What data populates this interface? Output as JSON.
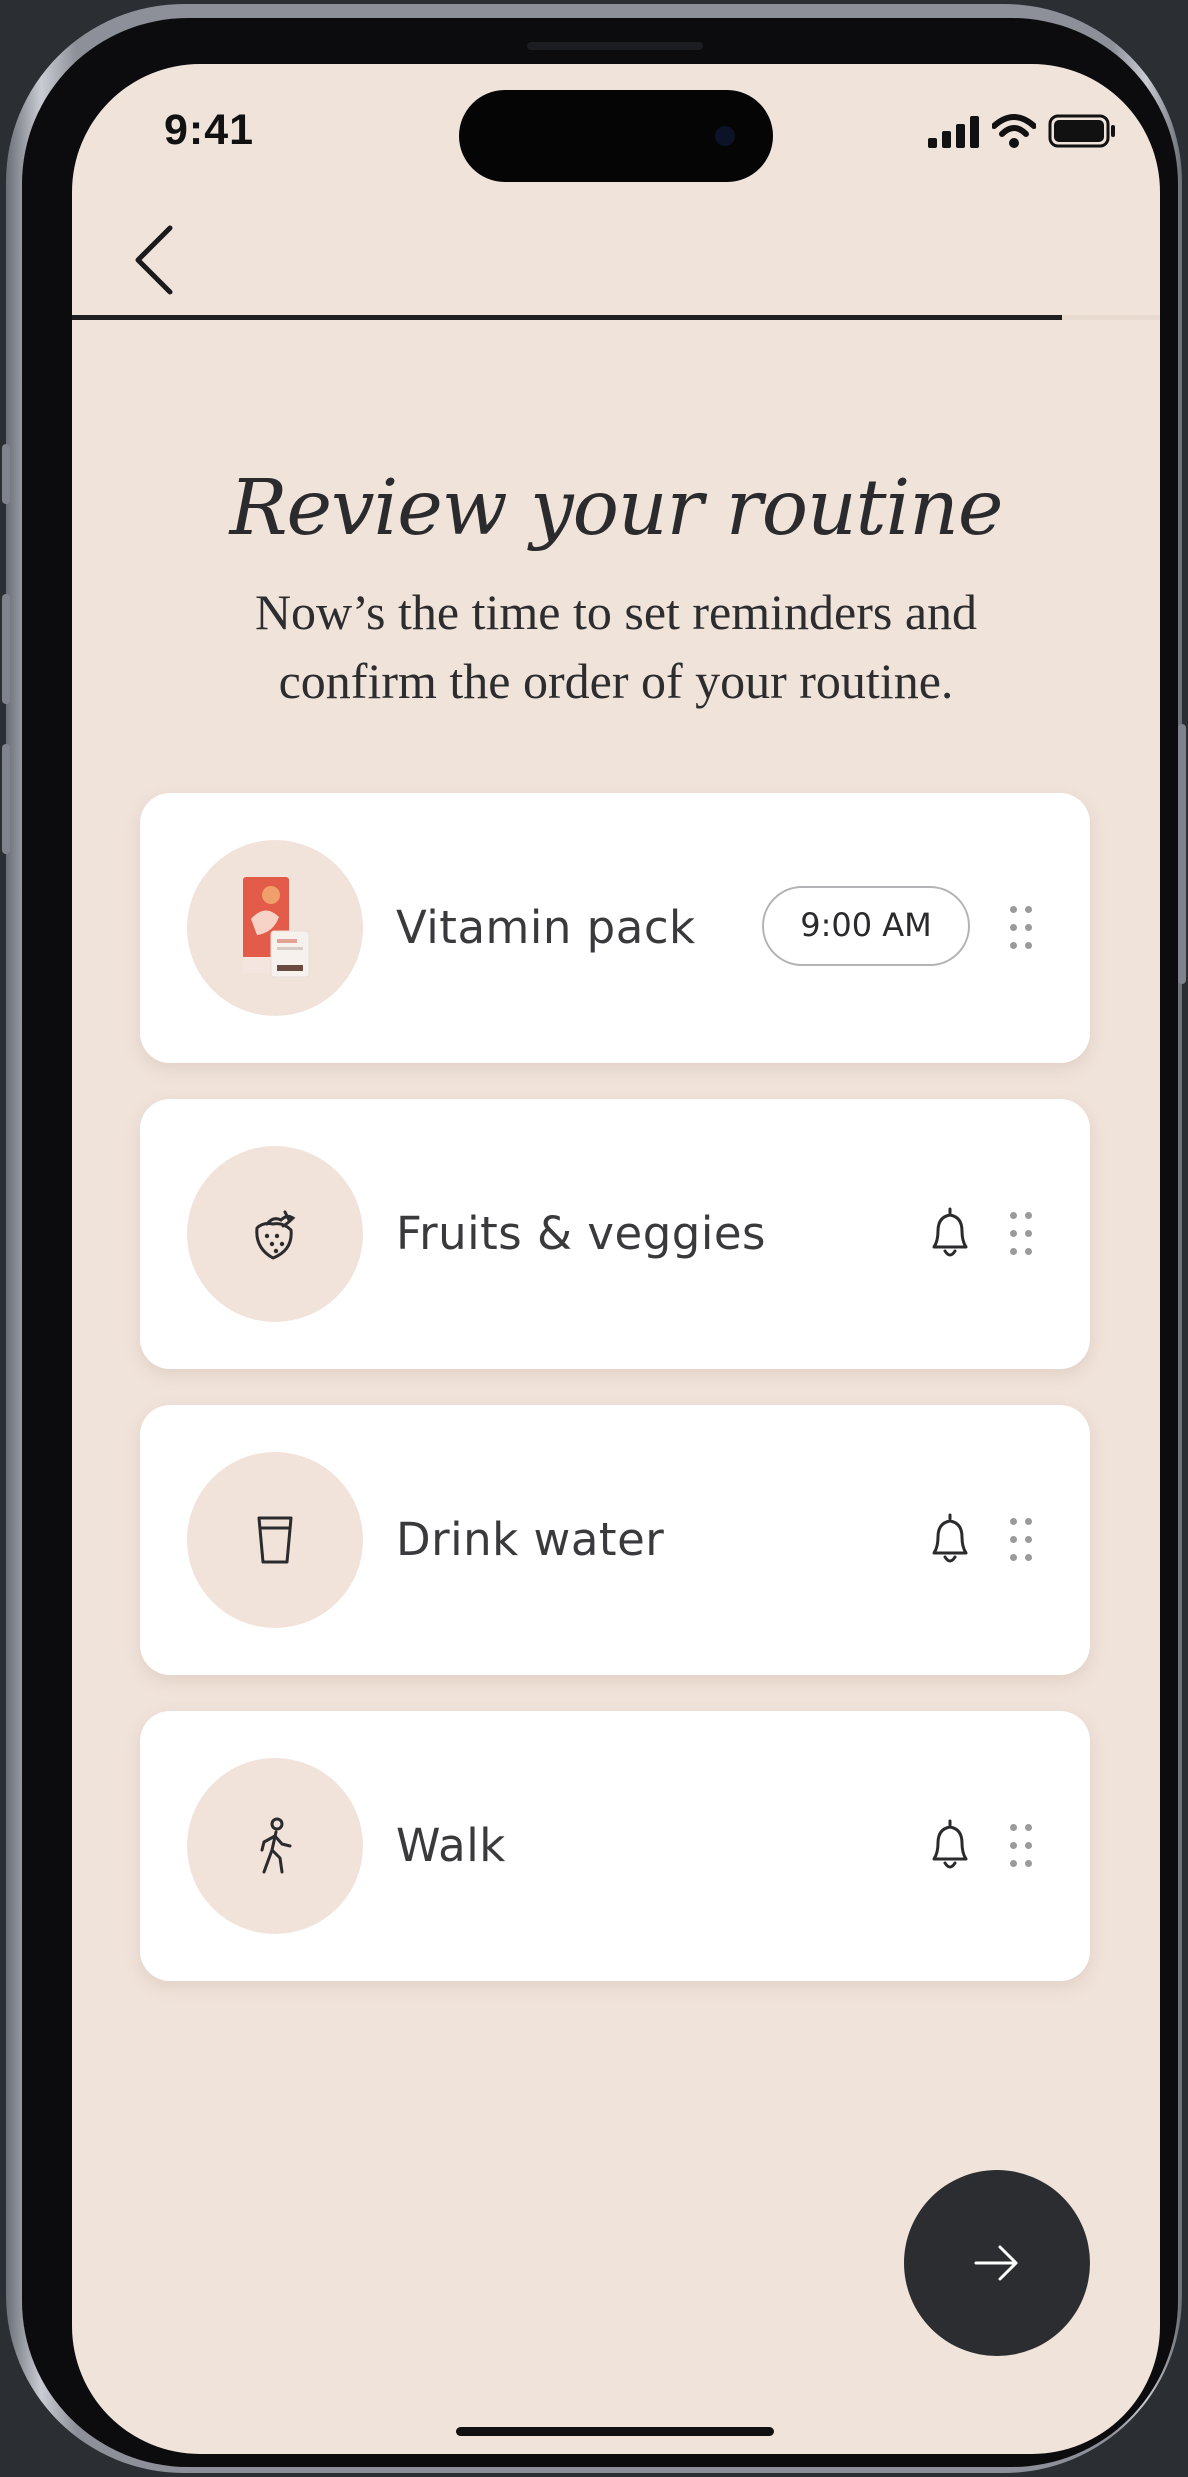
{
  "status_bar": {
    "time": "9:41"
  },
  "header": {
    "back_icon": "chevron-left-icon",
    "progress": 0.91
  },
  "page": {
    "title": "Review your routine",
    "subtitle": "Now’s the time to set reminders and confirm the order of your routine."
  },
  "routine": {
    "items": [
      {
        "label": "Vitamin pack",
        "icon": "vitamin-pack-image",
        "reminder_time": "9:00 AM",
        "drag_icon": "drag-handle-icon"
      },
      {
        "label": "Fruits & veggies",
        "icon": "strawberry-icon",
        "reminder_icon": "bell-icon",
        "drag_icon": "drag-handle-icon"
      },
      {
        "label": "Drink water",
        "icon": "glass-icon",
        "reminder_icon": "bell-icon",
        "drag_icon": "drag-handle-icon"
      },
      {
        "label": "Walk",
        "icon": "walking-person-icon",
        "reminder_icon": "bell-icon",
        "drag_icon": "drag-handle-icon"
      }
    ]
  },
  "footer": {
    "next_icon": "arrow-right-icon"
  },
  "colors": {
    "background": "#f0e3da",
    "card": "#ffffff",
    "icon_circle": "#f1e3da",
    "text": "#3a3a3d",
    "fab": "#2b2d30",
    "progress": "#1f1f21"
  }
}
